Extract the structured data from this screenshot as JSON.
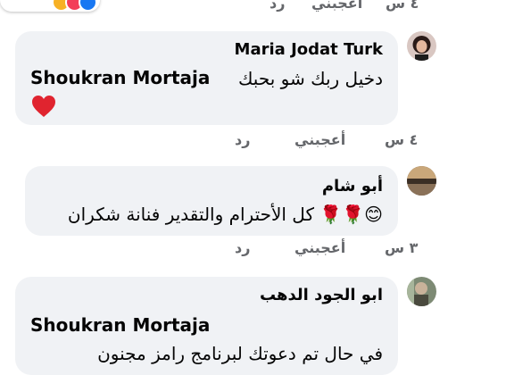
{
  "top_row": {
    "reply": "رد",
    "like": "أعجبني",
    "time": "٤ س"
  },
  "comments": [
    {
      "author": "Maria Jodat Turk",
      "mention": "Shoukran Mortaja",
      "text": "دخيل ربك شو بحبك",
      "emoji": "❤️",
      "time": "٤ س",
      "like": "أعجبني",
      "reply": "رد"
    },
    {
      "author": "أبو شام",
      "text": "كل الأحترام والتقدير فنانة شكران 🌹🌹😊",
      "time": "٣ س",
      "like": "أعجبني",
      "reply": "رد"
    },
    {
      "author": "ابو الجود الدهب",
      "mention": "Shoukran Mortaja",
      "text": "في حال تم دعوتك لبرنامج رامز مجنون"
    }
  ],
  "colors": {
    "bubble": "#f0f2f5",
    "text": "#050505",
    "secondary": "#65676b"
  }
}
